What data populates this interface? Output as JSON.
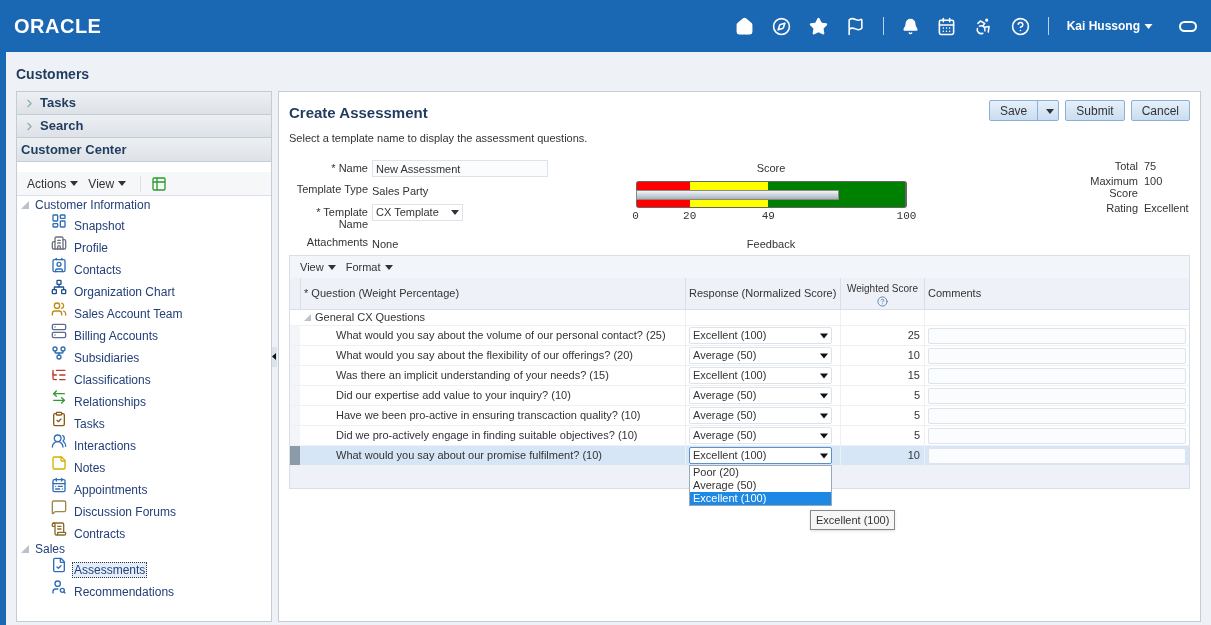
{
  "header": {
    "logo": "ORACLE",
    "user": "Kai Hussong"
  },
  "page_title": "Customers",
  "sidebar": {
    "panels": [
      {
        "label": "Tasks",
        "expanded": false
      },
      {
        "label": "Search",
        "expanded": false
      }
    ],
    "section_title": "Customer Center",
    "toolbar": [
      "Actions",
      "View"
    ],
    "tree": [
      {
        "label": "Customer Information",
        "expanded": true,
        "children": [
          {
            "label": "Snapshot",
            "selected": false
          },
          {
            "label": "Profile",
            "selected": false
          },
          {
            "label": "Contacts",
            "selected": false
          },
          {
            "label": "Organization Chart",
            "selected": false
          },
          {
            "label": "Sales Account Team",
            "selected": false
          },
          {
            "label": "Billing Accounts",
            "selected": false
          },
          {
            "label": "Subsidiaries",
            "selected": false
          },
          {
            "label": "Classifications",
            "selected": false
          },
          {
            "label": "Relationships",
            "selected": false
          },
          {
            "label": "Tasks",
            "selected": false
          },
          {
            "label": "Interactions",
            "selected": false
          },
          {
            "label": "Notes",
            "selected": false
          },
          {
            "label": "Appointments",
            "selected": false
          },
          {
            "label": "Discussion Forums",
            "selected": false
          },
          {
            "label": "Contracts",
            "selected": false
          }
        ]
      },
      {
        "label": "Sales",
        "expanded": true,
        "children": [
          {
            "label": "Assessments",
            "selected": true
          },
          {
            "label": "Recommendations",
            "selected": false
          }
        ]
      }
    ]
  },
  "main": {
    "title": "Create Assessment",
    "instruction": "Select a template name to display the assessment questions.",
    "buttons": [
      {
        "label": "Save",
        "kind": "split"
      },
      {
        "label": "Submit",
        "kind": "plain"
      },
      {
        "label": "Cancel",
        "kind": "plain"
      }
    ],
    "fields": [
      {
        "label": "* Name",
        "kind": "input",
        "value": "New Assessment"
      },
      {
        "label": "Template Type",
        "kind": "text",
        "value": "Sales Party"
      },
      {
        "label": "* Template Name",
        "kind": "select",
        "value": "CX Template"
      },
      {
        "label": "Attachments",
        "kind": "text",
        "value": "None"
      }
    ],
    "gauge": {
      "title": "Score",
      "level": 0.75,
      "ticks": [
        "0",
        "20",
        "49",
        "100"
      ],
      "bands": [
        {
          "color": "#ff0000"
        },
        {
          "color": "#ffff00"
        },
        {
          "color": "#008000"
        }
      ],
      "caption": "Feedback"
    },
    "summary": [
      {
        "label": "Total",
        "value": "75"
      },
      {
        "label": "Maximum Score",
        "value": "100"
      },
      {
        "label": "Rating",
        "value": "Excellent"
      }
    ],
    "table": {
      "toolbar": [
        "View",
        "Format"
      ],
      "columns": [
        "* Question (Weight Percentage)",
        "Response (Normalized Score)",
        "Weighted Score",
        "Comments"
      ],
      "group": {
        "label": "General CX Questions",
        "expanded": true
      },
      "rows": [
        {
          "question": "What would you say about the volume of our personal contact? (25)",
          "response": "Excellent (100)",
          "score": "25",
          "selected": false,
          "open": false
        },
        {
          "question": "What would you say about the flexibility of our offerings? (20)",
          "response": "Average (50)",
          "score": "10",
          "selected": false,
          "open": false
        },
        {
          "question": "Was there an implicit understanding of your needs? (15)",
          "response": "Excellent (100)",
          "score": "15",
          "selected": false,
          "open": false
        },
        {
          "question": "Did our expertise add value to your inquiry? (10)",
          "response": "Average (50)",
          "score": "5",
          "selected": false,
          "open": false
        },
        {
          "question": "Have we been pro-active in ensuring transcaction quality? (10)",
          "response": "Average (50)",
          "score": "5",
          "selected": false,
          "open": false
        },
        {
          "question": "Did we pro-actively engage in finding suitable objectives? (10)",
          "response": "Average (50)",
          "score": "5",
          "selected": false,
          "open": false
        },
        {
          "question": "What would you say about our promise fulfilment? (10)",
          "response": "Excellent (100)",
          "score": "10",
          "selected": true,
          "open": true
        }
      ],
      "options": [
        {
          "label": "Poor (20)",
          "selected": false
        },
        {
          "label": "Average (50)",
          "selected": false
        },
        {
          "label": "Excellent (100)",
          "selected": true
        }
      ],
      "tooltip": "Excellent (100)"
    }
  }
}
